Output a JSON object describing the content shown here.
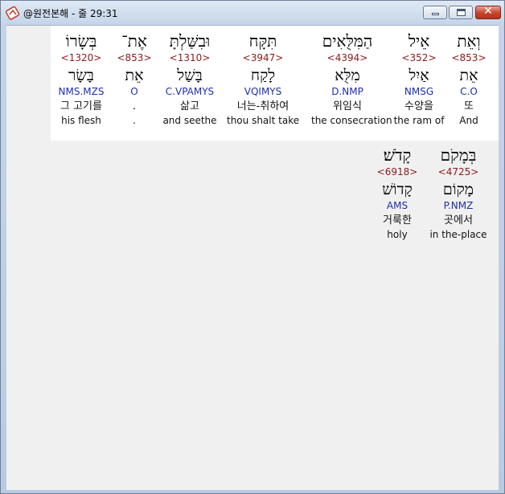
{
  "window": {
    "title": "@원전본해 - 줄 29:31",
    "buttons": {
      "minimize": "minimize",
      "maximize": "maximize",
      "close": "✕"
    }
  },
  "verse_rows": [
    [
      {
        "hebrew": "וְאֵת",
        "strong": "<853>",
        "lemma": "אֵת",
        "morph": "C.O",
        "korean": "또",
        "english": "And"
      },
      {
        "hebrew": "אֵיל",
        "strong": "<352>",
        "lemma": "אַיִל",
        "morph": "NMSG",
        "korean": "수양을",
        "english": "the ram of"
      },
      {
        "hebrew": "הַמִּלֻּאִים",
        "strong": "<4394>",
        "lemma": "מִלֻּא",
        "morph": "D.NMP",
        "korean": "위임식",
        "english": "the consecration"
      },
      {
        "hebrew": "תִּקָּח",
        "strong": "<3947>",
        "lemma": "לָקַח",
        "morph": "VQIMYS",
        "korean": "너는-취하여",
        "english": "thou shalt take"
      },
      {
        "hebrew": "וּבִשַּׁלְתָּ",
        "strong": "<1310>",
        "lemma": "בָּשַׁל",
        "morph": "C.VPAMYS",
        "korean": "삶고",
        "english": "and seethe"
      },
      {
        "hebrew": "אֶת־",
        "strong": "<853>",
        "lemma": "אֵת",
        "morph": "O",
        "korean": ".",
        "english": "."
      },
      {
        "hebrew": "בְּשָׂרוֹ",
        "strong": "<1320>",
        "lemma": "בָּשָׂר",
        "morph": "NMS.MZS",
        "korean": "그 고기를",
        "english": "his flesh"
      }
    ],
    [
      {
        "hebrew": "בְּמָקֹם",
        "strong": "<4725>",
        "lemma": "מָקוֹם",
        "morph": "P.NMZ",
        "korean": "곳에서",
        "english": "in the-place"
      },
      {
        "hebrew": "קָדֹשׁ׃",
        "strong": "<6918>",
        "lemma": "קָדוֹשׁ",
        "morph": "AMS",
        "korean": "거룩한",
        "english": "holy"
      }
    ]
  ]
}
